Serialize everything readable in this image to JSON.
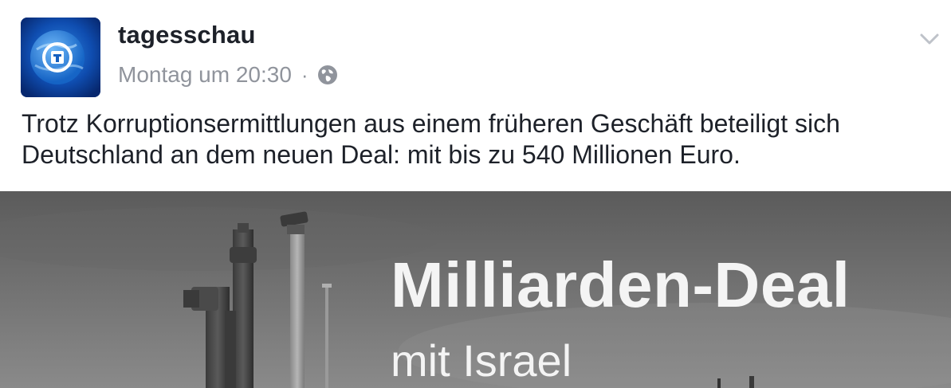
{
  "post": {
    "author": "tagesschau",
    "timestamp": "Montag um 20:30",
    "separator": "·",
    "audience_icon": "globe-icon",
    "menu_icon": "chevron-down-icon",
    "text": "Trotz Korruptionsermittlungen aus einem früheren Geschäft beteiligt sich Deutschland an dem neuen Deal: mit bis zu 540 Millionen Euro."
  },
  "media": {
    "headline": "Milliarden-Deal",
    "subline": "mit Israel"
  },
  "colors": {
    "text": "#1d2129",
    "meta": "#90949c",
    "logo_blue": "#0b3a8f",
    "image_gray": "#6f6f6f"
  }
}
